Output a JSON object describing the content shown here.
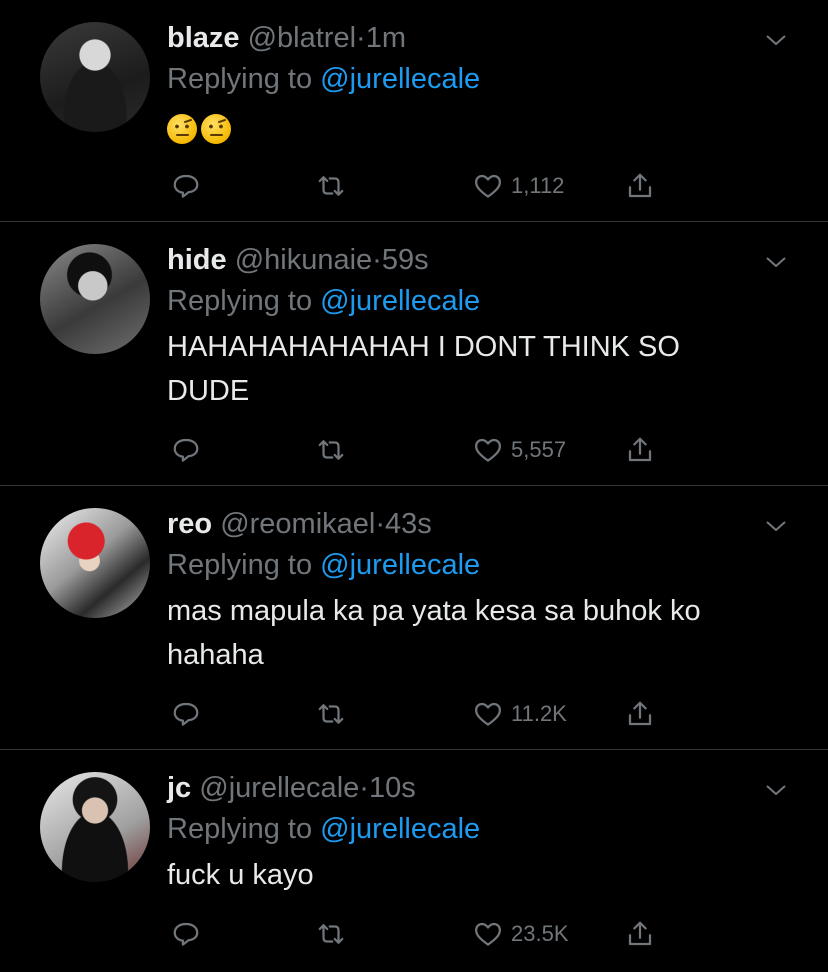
{
  "tweets": [
    {
      "name": "blaze",
      "handle": "@blatrel",
      "separator": "·",
      "time": "1m",
      "replying_prefix": "Replying to",
      "replying_handle": "@jurellecale",
      "text_line1": "",
      "text_line2": "",
      "emojis": [
        "raised-eyebrow-emoji",
        "raised-eyebrow-emoji"
      ],
      "likes": "1,112"
    },
    {
      "name": "hide",
      "handle": "@hikunaie",
      "separator": "·",
      "time": "59s",
      "replying_prefix": "Replying to",
      "replying_handle": "@jurellecale",
      "text_line1": "HAHAHAHAHAHAH I DONT THINK SO",
      "text_line2": "DUDE",
      "likes": "5,557"
    },
    {
      "name": "reo",
      "handle": "@reomikael",
      "separator": "·",
      "time": "43s",
      "replying_prefix": "Replying to",
      "replying_handle": "@jurellecale",
      "text_line1": "mas mapula ka pa yata kesa sa buhok ko",
      "text_line2": "hahaha",
      "likes": "11.2K"
    },
    {
      "name": "jc",
      "handle": "@jurellecale",
      "separator": "·",
      "time": "10s",
      "replying_prefix": "Replying to",
      "replying_handle": "@jurellecale",
      "text_line1": "fuck u kayo",
      "text_line2": "",
      "likes": "23.5K"
    }
  ],
  "colors": {
    "background": "#000000",
    "text": "#e7e9ea",
    "muted": "#71767b",
    "link": "#1d9bf0",
    "divider": "#2f3336"
  },
  "icons": {
    "reply": "reply-icon",
    "retweet": "retweet-icon",
    "like": "heart-icon",
    "share": "share-icon",
    "menu": "chevron-down-icon"
  }
}
